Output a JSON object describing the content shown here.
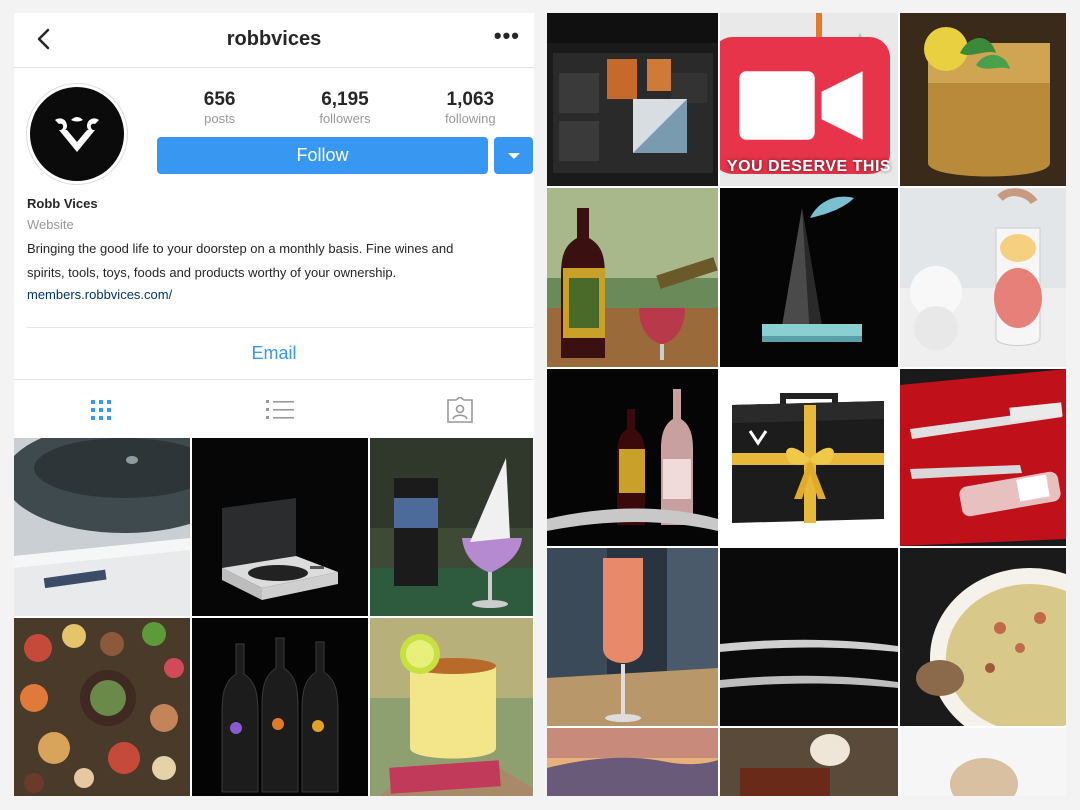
{
  "header": {
    "username": "robbvices"
  },
  "stats": [
    {
      "value": "656",
      "label": "posts"
    },
    {
      "value": "6,195",
      "label": "followers"
    },
    {
      "value": "1,063",
      "label": "following"
    }
  ],
  "buttons": {
    "follow": "Follow",
    "email": "Email"
  },
  "bio": {
    "name": "Robb Vices",
    "category": "Website",
    "line1": "Bringing the good life to your doorstep on a monthly basis. Fine wines and",
    "line2": "spirits, tools, toys, foods and products worthy of your ownership.",
    "link": "members.robbvices.com/"
  },
  "posts": {
    "overlay": "YOU DESERVE THIS"
  },
  "colors": {
    "accent": "#3897f0",
    "link": "#003569",
    "muted": "#999999"
  }
}
